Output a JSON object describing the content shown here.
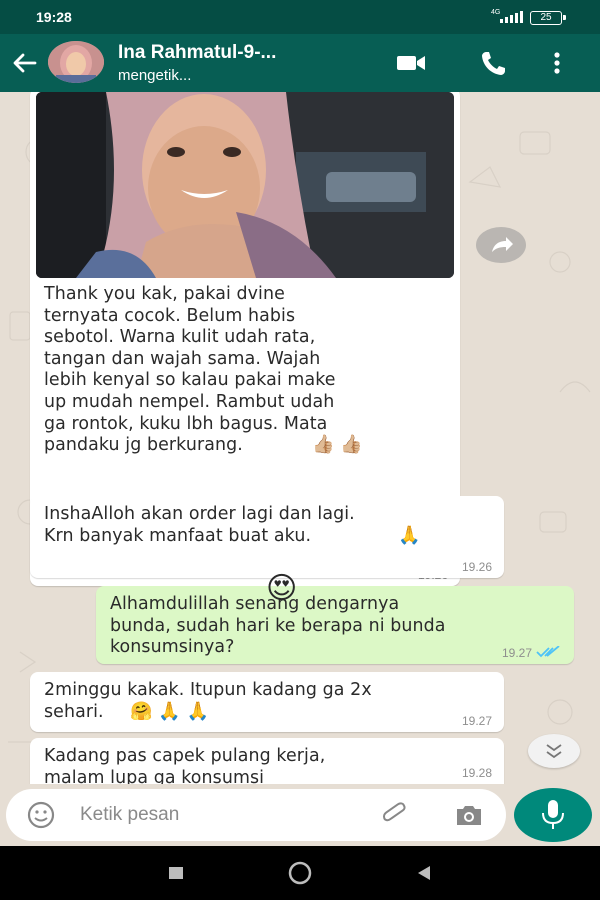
{
  "status_bar": {
    "time": "19:28",
    "network": "4G",
    "battery": "25"
  },
  "header": {
    "contact_name": "Ina Rahmatul-9-...",
    "status": "mengetik...",
    "icons": [
      "back-arrow-icon",
      "video-call-icon",
      "phone-call-icon",
      "more-vert-icon"
    ]
  },
  "messages": [
    {
      "direction": "incoming",
      "has_image": true,
      "text": "Thank you kak, pakai dvine\nternyata cocok. Belum habis\nsebotol. Warna kulit udah rata,\ntangan dan wajah sama. Wajah\nlebih kenyal so kalau pakai make\nup mudah nempel. Rambut udah\nga rontok, kuku lbh bagus. Mata\npandaku jg berkurang.",
      "emoji": "👍🏼 👍🏼",
      "time": "19.26"
    },
    {
      "direction": "incoming",
      "text": "InshaAlloh akan order lagi dan lagi.\nKrn banyak manfaat buat aku.",
      "emoji": "🙏",
      "time": "19.26"
    },
    {
      "direction": "outgoing",
      "text": "Alhamdulillah      senang dengarnya\nbunda, sudah hari ke berapa ni bunda\nkonsumsinya?",
      "emoji": "😍",
      "time": "19.27",
      "read": true
    },
    {
      "direction": "incoming",
      "text": "2minggu kakak. Itupun kadang ga 2x\nsehari.",
      "emoji": "🤗 🙏 🙏",
      "time": "19.27"
    },
    {
      "direction": "incoming",
      "text": "Kadang pas capek pulang kerja,\nmalam lupa ga konsumsi",
      "time": "19.28"
    }
  ],
  "composer": {
    "placeholder": "Ketik pesan"
  },
  "colors": {
    "header": "#075e54",
    "status_bar": "#054d44",
    "outgoing_bubble": "#dcf8c6",
    "incoming_bubble": "#ffffff",
    "chat_bg": "#e6ded4",
    "mic_button": "#00897b",
    "read_ticks": "#4fc3f7"
  }
}
